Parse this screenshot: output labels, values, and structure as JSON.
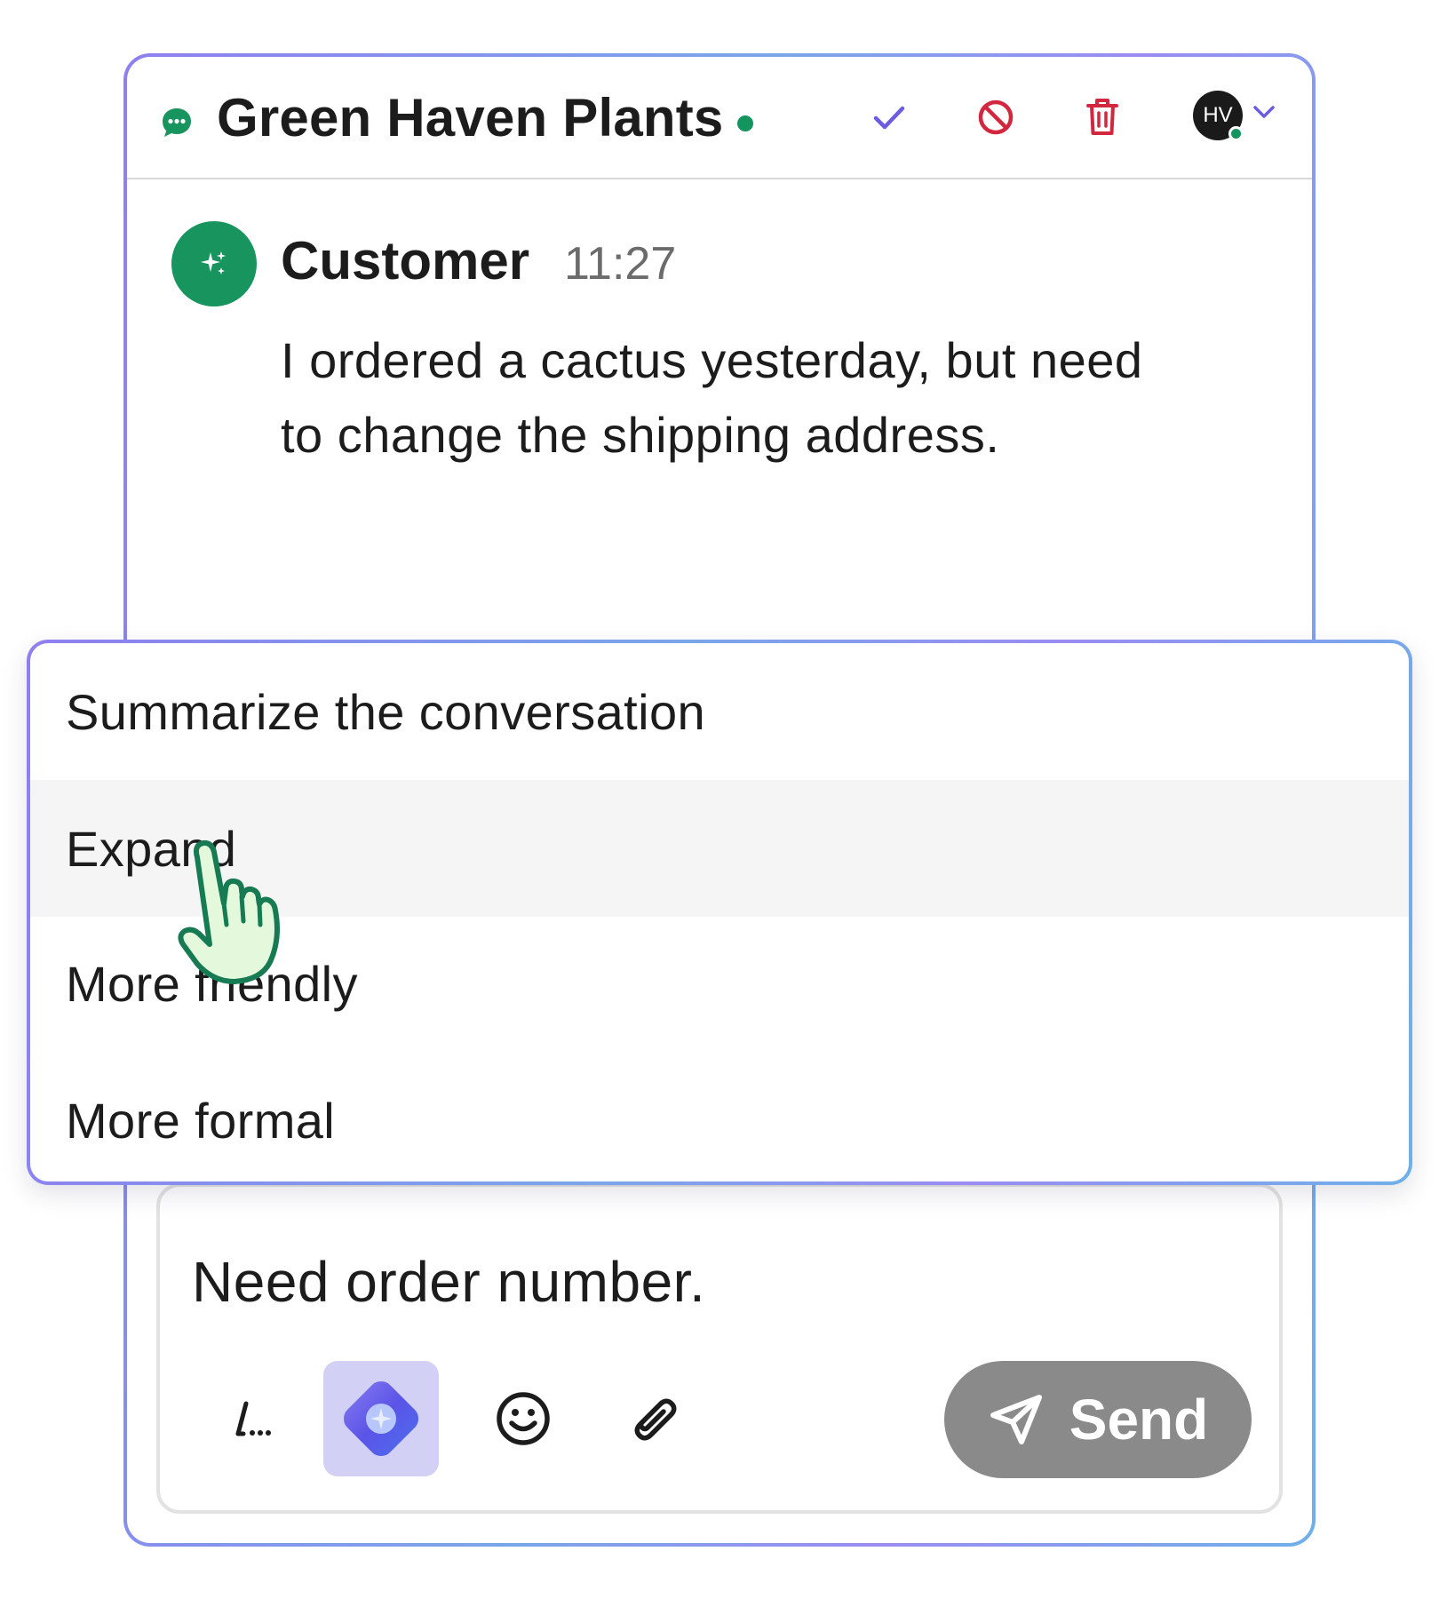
{
  "header": {
    "title": "Green Haven Plants",
    "status": "online",
    "avatar_initials": "HV",
    "icons": [
      "chat-bubble-icon",
      "check-icon",
      "block-icon",
      "trash-icon",
      "chevron-down-icon"
    ]
  },
  "message": {
    "sender": "Customer",
    "time": "11:27",
    "text": "I ordered a cactus yesterday, but need to change the shipping address."
  },
  "menu": {
    "items": [
      {
        "label": "Summarize the conversation"
      },
      {
        "label": "Expand"
      },
      {
        "label": "More friendly"
      },
      {
        "label": "More formal"
      }
    ],
    "hovered_index": 1
  },
  "composer": {
    "draft": "Need order number.",
    "tools": [
      "shortcut-icon",
      "ai-assist-icon",
      "emoji-icon",
      "attach-icon"
    ],
    "send_label": "Send"
  },
  "colors": {
    "brand_green": "#18955f",
    "danger": "#d2273f",
    "accent_purple": "#6c5ce0",
    "send_disabled": "#8a8a8a",
    "ai_button_bg": "#d2d0f4"
  }
}
